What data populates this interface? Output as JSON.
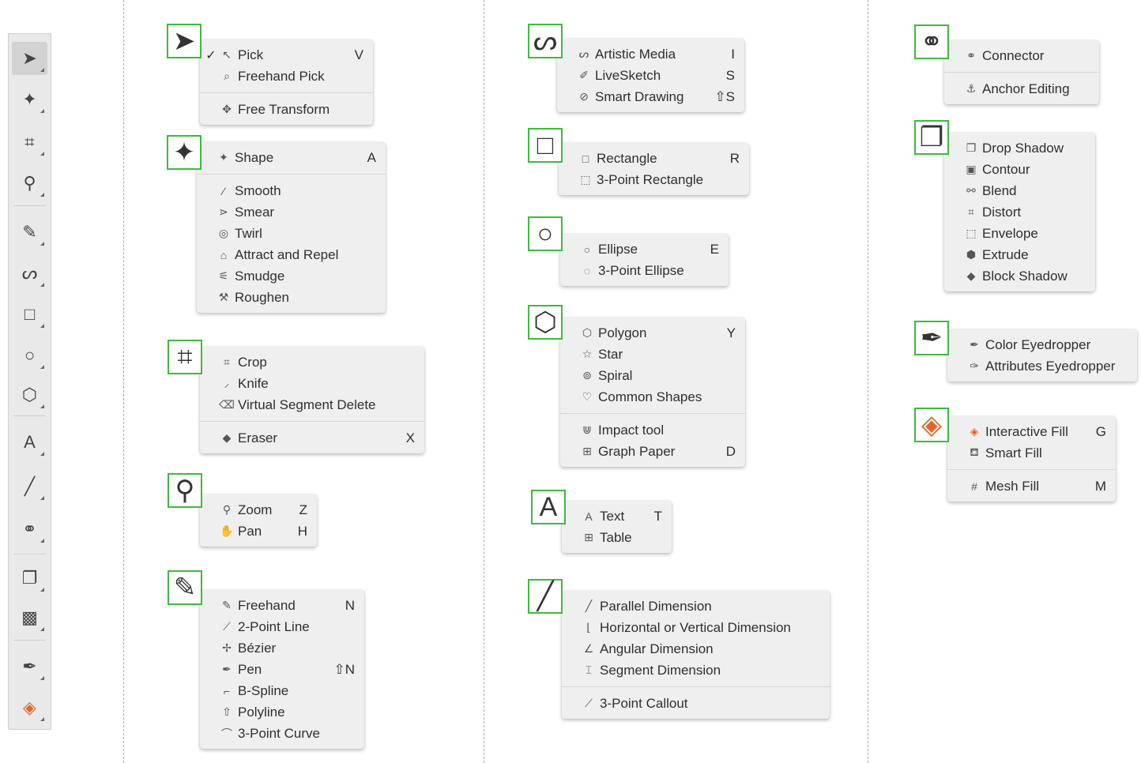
{
  "colors": {
    "highlight_border": "#3dbb3d",
    "flyout_bg": "#efefef",
    "toolbar_bg": "#e9e9e9",
    "fill_accent": "#e0662a"
  },
  "toolbar": {
    "tools": [
      {
        "icon": "pick-icon",
        "glyph": "➤"
      },
      {
        "icon": "shape-icon",
        "glyph": "✦"
      },
      {
        "icon": "crop-icon",
        "glyph": "⌗"
      },
      {
        "icon": "zoom-icon",
        "glyph": "⚲"
      },
      {
        "icon": "freehand-icon",
        "glyph": "✎"
      },
      {
        "icon": "artistic-media-icon",
        "glyph": "ᔕ"
      },
      {
        "icon": "rectangle-icon",
        "glyph": "□"
      },
      {
        "icon": "ellipse-icon",
        "glyph": "○"
      },
      {
        "icon": "polygon-icon",
        "glyph": "⬡"
      },
      {
        "icon": "text-icon",
        "glyph": "A"
      },
      {
        "icon": "dimension-icon",
        "glyph": "╱"
      },
      {
        "icon": "connector-icon",
        "glyph": "⚭"
      },
      {
        "icon": "drop-shadow-icon",
        "glyph": "❐"
      },
      {
        "icon": "transparency-icon",
        "glyph": "▩"
      },
      {
        "icon": "eyedropper-icon",
        "glyph": "✒"
      },
      {
        "icon": "interactive-fill-icon",
        "glyph": "◈"
      }
    ]
  },
  "flyouts": {
    "pick": {
      "icon": "pick-icon",
      "glyph": "➤",
      "items": [
        {
          "label": "Pick",
          "shortcut": "V",
          "check": "✓",
          "icon": "↖"
        },
        {
          "label": "Freehand Pick",
          "shortcut": "",
          "icon": "⌕"
        },
        {
          "sep": true
        },
        {
          "label": "Free Transform",
          "shortcut": "",
          "icon": "✥"
        }
      ]
    },
    "shape": {
      "icon": "shape-icon",
      "glyph": "✦",
      "items": [
        {
          "label": "Shape",
          "shortcut": "A",
          "icon": "✦"
        },
        {
          "sep": true
        },
        {
          "label": "Smooth",
          "shortcut": "",
          "icon": "⁄"
        },
        {
          "label": "Smear",
          "shortcut": "",
          "icon": "⋗"
        },
        {
          "label": "Twirl",
          "shortcut": "",
          "icon": "◎"
        },
        {
          "label": "Attract and Repel",
          "shortcut": "",
          "icon": "⌂"
        },
        {
          "label": "Smudge",
          "shortcut": "",
          "icon": "⚟"
        },
        {
          "label": "Roughen",
          "shortcut": "",
          "icon": "⚒"
        }
      ]
    },
    "crop": {
      "icon": "crop-icon",
      "glyph": "⌗",
      "items": [
        {
          "label": "Crop",
          "shortcut": "",
          "icon": "⌗"
        },
        {
          "label": "Knife",
          "shortcut": "",
          "icon": "⸝"
        },
        {
          "label": "Virtual Segment Delete",
          "shortcut": "",
          "icon": "⌫"
        },
        {
          "sep": true
        },
        {
          "label": "Eraser",
          "shortcut": "X",
          "icon": "◆"
        }
      ]
    },
    "zoom": {
      "icon": "zoom-icon",
      "glyph": "⚲",
      "items": [
        {
          "label": "Zoom",
          "shortcut": "Z",
          "icon": "⚲"
        },
        {
          "label": "Pan",
          "shortcut": "H",
          "icon": "✋"
        }
      ]
    },
    "freehand": {
      "icon": "freehand-icon",
      "glyph": "✎",
      "items": [
        {
          "label": "Freehand",
          "shortcut": "N",
          "icon": "✎"
        },
        {
          "label": "2-Point Line",
          "shortcut": "",
          "icon": "⟋"
        },
        {
          "label": "Bézier",
          "shortcut": "",
          "icon": "✢"
        },
        {
          "label": "Pen",
          "shortcut": "⇧N",
          "icon": "✒"
        },
        {
          "label": "B-Spline",
          "shortcut": "",
          "icon": "⌐"
        },
        {
          "label": "Polyline",
          "shortcut": "",
          "icon": "⇧"
        },
        {
          "label": "3-Point Curve",
          "shortcut": "",
          "icon": "⌒"
        }
      ]
    },
    "artistic": {
      "icon": "artistic-media-icon",
      "glyph": "ᔕ",
      "items": [
        {
          "label": "Artistic Media",
          "shortcut": "I",
          "icon": "ᔕ"
        },
        {
          "label": "LiveSketch",
          "shortcut": "S",
          "icon": "✐"
        },
        {
          "label": "Smart Drawing",
          "shortcut": "⇧S",
          "icon": "⊘"
        }
      ]
    },
    "rectangle": {
      "icon": "rectangle-icon",
      "glyph": "□",
      "items": [
        {
          "label": "Rectangle",
          "shortcut": "R",
          "icon": "□"
        },
        {
          "label": "3-Point Rectangle",
          "shortcut": "",
          "icon": "⬚"
        }
      ]
    },
    "ellipse": {
      "icon": "ellipse-icon",
      "glyph": "○",
      "items": [
        {
          "label": "Ellipse",
          "shortcut": "E",
          "icon": "○"
        },
        {
          "label": "3-Point Ellipse",
          "shortcut": "",
          "icon": "◌"
        }
      ]
    },
    "polygon": {
      "icon": "polygon-icon",
      "glyph": "⬡",
      "items": [
        {
          "label": "Polygon",
          "shortcut": "Y",
          "icon": "⬡"
        },
        {
          "label": "Star",
          "shortcut": "",
          "icon": "☆"
        },
        {
          "label": "Spiral",
          "shortcut": "",
          "icon": "⊚"
        },
        {
          "label": "Common Shapes",
          "shortcut": "",
          "icon": "♡"
        },
        {
          "sep": true
        },
        {
          "label": "Impact tool",
          "shortcut": "",
          "icon": "⋓"
        },
        {
          "label": "Graph Paper",
          "shortcut": "D",
          "icon": "⊞"
        }
      ]
    },
    "text": {
      "icon": "text-icon",
      "glyph": "A",
      "items": [
        {
          "label": "Text",
          "shortcut": "T",
          "icon": "A"
        },
        {
          "label": "Table",
          "shortcut": "",
          "icon": "⊞"
        }
      ]
    },
    "dimension": {
      "icon": "dimension-icon",
      "glyph": "╱",
      "items": [
        {
          "label": "Parallel Dimension",
          "shortcut": "",
          "icon": "╱"
        },
        {
          "label": "Horizontal or Vertical Dimension",
          "shortcut": "",
          "icon": "⌊"
        },
        {
          "label": "Angular Dimension",
          "shortcut": "",
          "icon": "∠"
        },
        {
          "label": "Segment Dimension",
          "shortcut": "",
          "icon": "⌶"
        },
        {
          "sep": true
        },
        {
          "label": "3-Point Callout",
          "shortcut": "",
          "icon": "⟋"
        }
      ]
    },
    "connector": {
      "icon": "connector-icon",
      "glyph": "⚭",
      "items": [
        {
          "label": "Connector",
          "shortcut": "",
          "icon": "⚭"
        },
        {
          "sep": true
        },
        {
          "label": "Anchor Editing",
          "shortcut": "",
          "icon": "⚓"
        }
      ]
    },
    "effects": {
      "icon": "drop-shadow-icon",
      "glyph": "❐",
      "items": [
        {
          "label": "Drop Shadow",
          "shortcut": "",
          "icon": "❐"
        },
        {
          "label": "Contour",
          "shortcut": "",
          "icon": "▣"
        },
        {
          "label": "Blend",
          "shortcut": "",
          "icon": "⚯"
        },
        {
          "label": "Distort",
          "shortcut": "",
          "icon": "⌗"
        },
        {
          "label": "Envelope",
          "shortcut": "",
          "icon": "⬚"
        },
        {
          "label": "Extrude",
          "shortcut": "",
          "icon": "⬢"
        },
        {
          "label": "Block Shadow",
          "shortcut": "",
          "icon": "◆"
        }
      ]
    },
    "eyedropper": {
      "icon": "eyedropper-icon",
      "glyph": "✒",
      "items": [
        {
          "label": "Color Eyedropper",
          "shortcut": "",
          "icon": "✒"
        },
        {
          "label": "Attributes Eyedropper",
          "shortcut": "",
          "icon": "✑"
        }
      ]
    },
    "fill": {
      "icon": "interactive-fill-icon",
      "glyph": "◈",
      "items": [
        {
          "label": "Interactive Fill",
          "shortcut": "G",
          "icon": "◈"
        },
        {
          "label": "Smart Fill",
          "shortcut": "",
          "icon": "⛾"
        },
        {
          "sep": true
        },
        {
          "label": "Mesh Fill",
          "shortcut": "M",
          "icon": "#"
        }
      ]
    }
  }
}
